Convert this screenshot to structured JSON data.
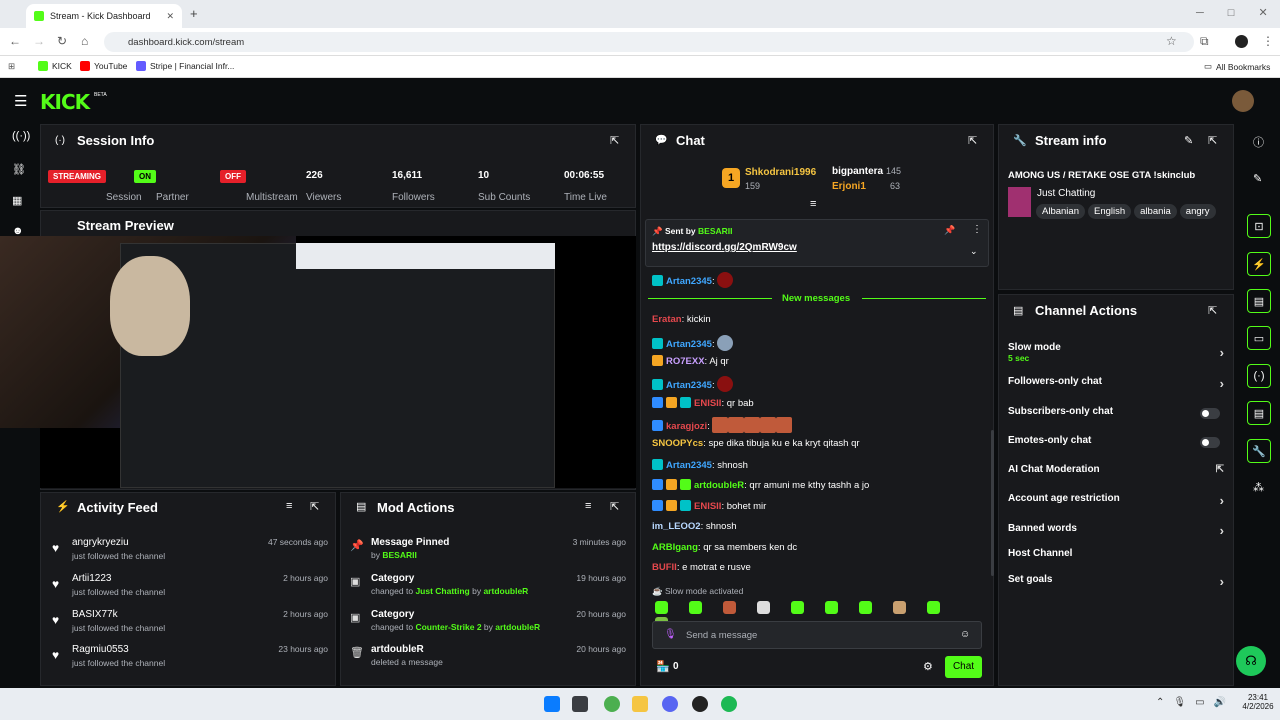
{
  "browser": {
    "tab_title": "Stream - Kick Dashboard",
    "url": "dashboard.kick.com/stream",
    "bookmarks": [
      "KICK",
      "YouTube",
      "Stripe | Financial Infr..."
    ],
    "all_bookmarks": "All Bookmarks"
  },
  "session": {
    "title": "Session Info",
    "streaming_badge": "STREAMING",
    "streaming_label": "Session",
    "partner_badge": "ON",
    "partner_label": "Partner",
    "multistream_badge": "OFF",
    "multistream_label": "Multistream",
    "viewers": "226",
    "viewers_label": "Viewers",
    "followers": "16,611",
    "followers_label": "Followers",
    "subs": "10",
    "subs_label": "Sub Counts",
    "time": "00:06:55",
    "time_label": "Time Live"
  },
  "preview": {
    "title": "Stream Preview"
  },
  "activity": {
    "title": "Activity Feed",
    "items": [
      {
        "name": "angrykryeziu",
        "sub": "just followed the channel",
        "time": "47 seconds ago"
      },
      {
        "name": "Artii1223",
        "sub": "just followed the channel",
        "time": "2 hours ago"
      },
      {
        "name": "BASIX77k",
        "sub": "just followed the channel",
        "time": "2 hours ago"
      },
      {
        "name": "Ragmiu0553",
        "sub": "just followed the channel",
        "time": "23 hours ago"
      }
    ]
  },
  "mod": {
    "title": "Mod Actions",
    "items": [
      {
        "name": "Message Pinned",
        "pre": "by ",
        "hl1": "BESARII",
        "mid": "",
        "hl2": "",
        "time": "3 minutes ago"
      },
      {
        "name": "Category",
        "pre": "changed to ",
        "hl1": "Just Chatting",
        "mid": " by ",
        "hl2": "artdoubleR",
        "time": "19 hours ago"
      },
      {
        "name": "Category",
        "pre": "changed to ",
        "hl1": "Counter-Strike 2",
        "mid": " by ",
        "hl2": "artdoubleR",
        "time": "20 hours ago"
      },
      {
        "name": "artdoubleR",
        "pre": "deleted a message",
        "hl1": "",
        "mid": "",
        "hl2": "",
        "time": "20 hours ago"
      }
    ]
  },
  "chat": {
    "title": "Chat",
    "leader1": "Shkodrani1996",
    "leader1_count": "159",
    "leader2": "bigpantera",
    "leader2_count": "145",
    "leader3": "Erjoni1",
    "leader3_count": "63",
    "pinned_by_label": "Sent by",
    "pinned_by": "BESARII",
    "pinned_link": "https://discord.gg/2QmRW9cw",
    "new_messages": "New messages",
    "slow_mode_note": "Slow mode activated",
    "input_placeholder": "Send a message",
    "chat_button": "Chat",
    "bottom_count": "0",
    "messages": [
      {
        "user": "Artan2345",
        "color": "#3fa7ff",
        "text": ""
      },
      {
        "user": "Eratan",
        "color": "#e5484d",
        "text": "kickin"
      },
      {
        "user": "Artan2345",
        "color": "#3fa7ff",
        "text": ""
      },
      {
        "user": "RO7EXX",
        "color": "#c9a0ff",
        "text": "Aj qr"
      },
      {
        "user": "Artan2345",
        "color": "#3fa7ff",
        "text": ""
      },
      {
        "user": "ENISII",
        "color": "#e5484d",
        "text": "qr bab"
      },
      {
        "user": "karagjozi",
        "color": "#e5484d",
        "text": ""
      },
      {
        "user": "SNOOPYcs",
        "color": "#f5c542",
        "text": "spe dika tibuja ku e ka kryt qitash qr"
      },
      {
        "user": "Artan2345",
        "color": "#3fa7ff",
        "text": "shnosh"
      },
      {
        "user": "artdoubleR",
        "color": "#53fc18",
        "text": "qrr amuni me kthy tashh a jo"
      },
      {
        "user": "ENISII",
        "color": "#e5484d",
        "text": "bohet mir"
      },
      {
        "user": "im_LEOO2",
        "color": "#b8d8ff",
        "text": "shnosh"
      },
      {
        "user": "ARBIgang",
        "color": "#53fc18",
        "text": "qr sa members ken dc"
      },
      {
        "user": "BUFII",
        "color": "#e5484d",
        "text": "e motrat e rusve"
      }
    ]
  },
  "stream_info": {
    "title": "Stream info",
    "stream_title": "AMONG US / RETAKE OSE GTA !skinclub",
    "category": "Just Chatting",
    "tags": [
      "Albanian",
      "English",
      "albania",
      "angry"
    ]
  },
  "actions": {
    "title": "Channel Actions",
    "slow_mode": "Slow mode",
    "slow_mode_value": "5 sec",
    "followers_only": "Followers-only chat",
    "subscribers_only": "Subscribers-only chat",
    "emotes_only": "Emotes-only chat",
    "ai_moderation": "AI Chat Moderation",
    "account_age": "Account age restriction",
    "banned_words": "Banned words",
    "host_channel": "Host Channel",
    "set_goals": "Set goals"
  },
  "taskbar": {
    "time": "23:41",
    "date": "4/2/2026"
  },
  "colors": {
    "brand": "#53fc18",
    "panel": "#18191c",
    "streaming": "#e5202a"
  }
}
